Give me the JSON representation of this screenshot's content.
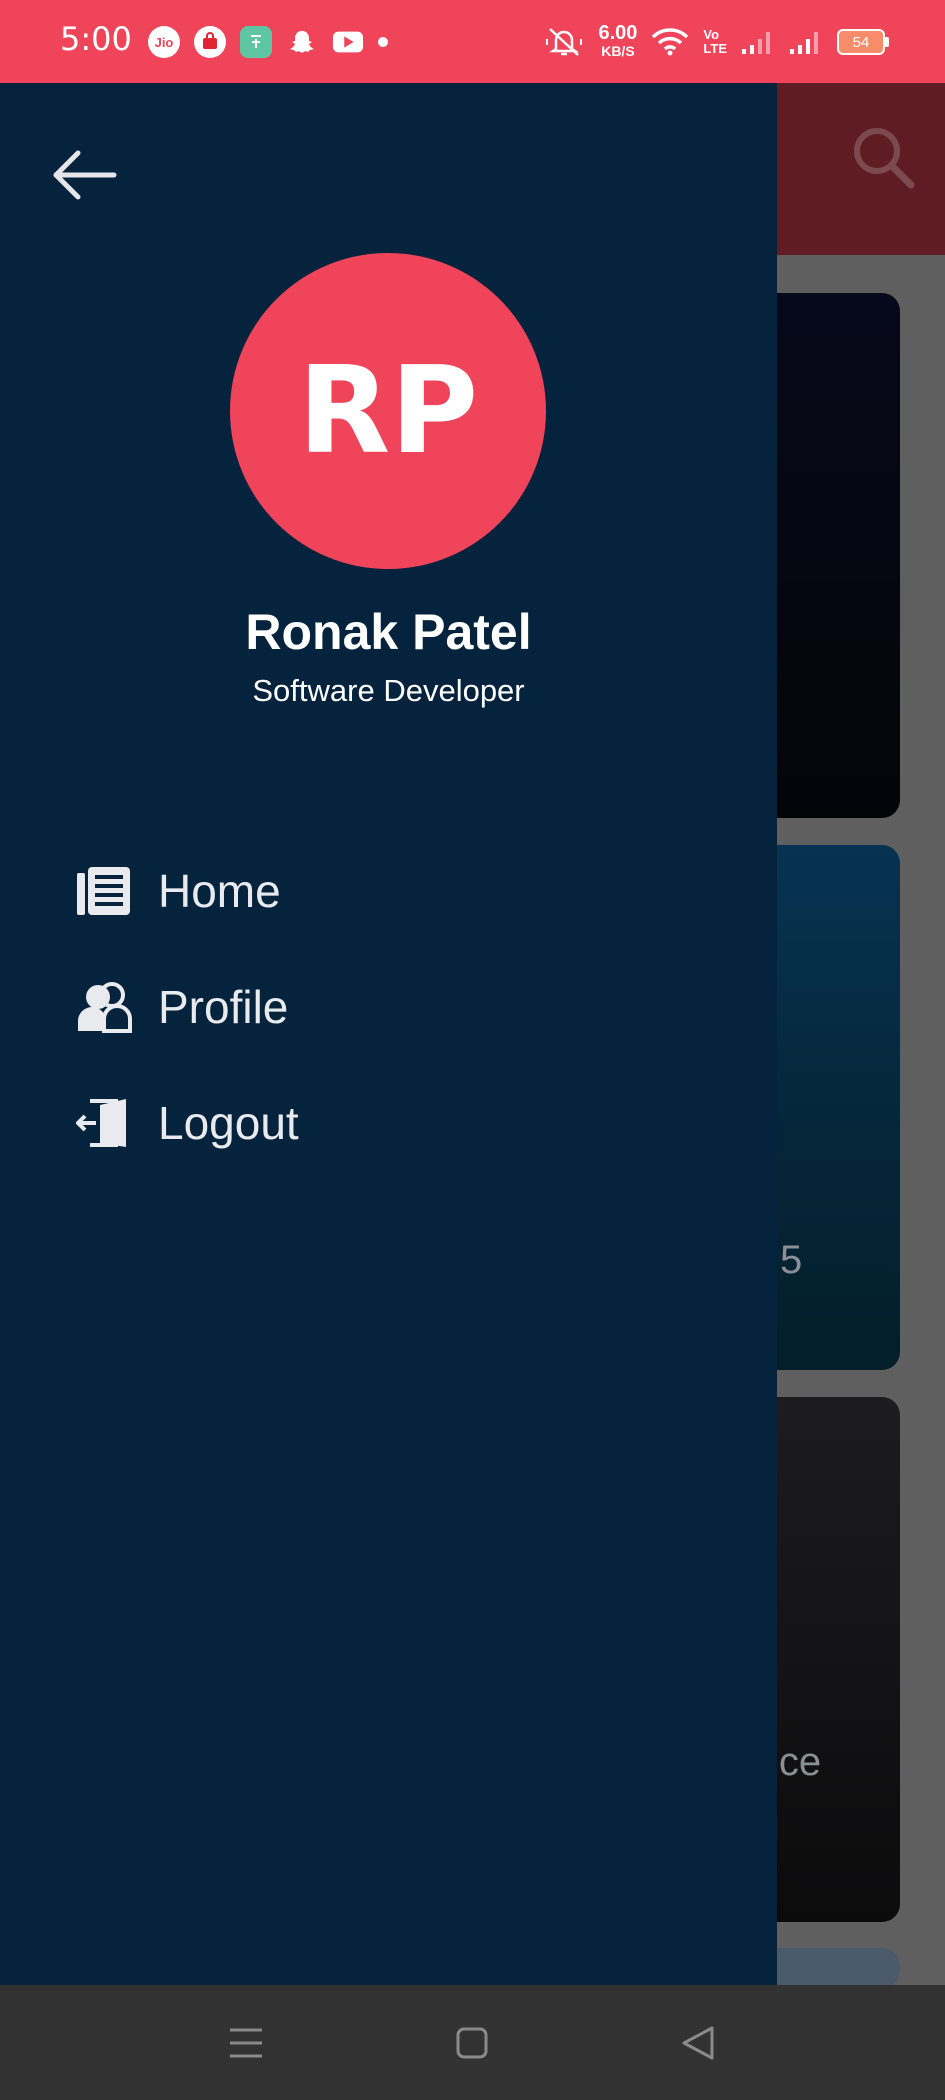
{
  "status_bar": {
    "time": "5:00",
    "app_icons": [
      "jio-icon",
      "shop-icon",
      "calculator-icon",
      "snapchat-icon",
      "youtube-icon"
    ],
    "jio_label": "Jio",
    "net_speed_value": "6.00",
    "net_speed_unit": "KB/S",
    "volte_label_1": "Vo",
    "volte_label_2": "LTE",
    "battery_level": "54"
  },
  "background": {
    "card2_text": "5",
    "card3_text": "ice"
  },
  "drawer": {
    "avatar_initials": "RP",
    "user_name": "Ronak Patel",
    "user_role": "Software Developer",
    "menu": [
      {
        "label": "Home",
        "icon": "home-icon"
      },
      {
        "label": "Profile",
        "icon": "profile-icon"
      },
      {
        "label": "Logout",
        "icon": "logout-icon"
      }
    ]
  },
  "colors": {
    "accent": "#ef4459",
    "drawer_bg": "#05233d",
    "navbar_bg": "#323232"
  }
}
